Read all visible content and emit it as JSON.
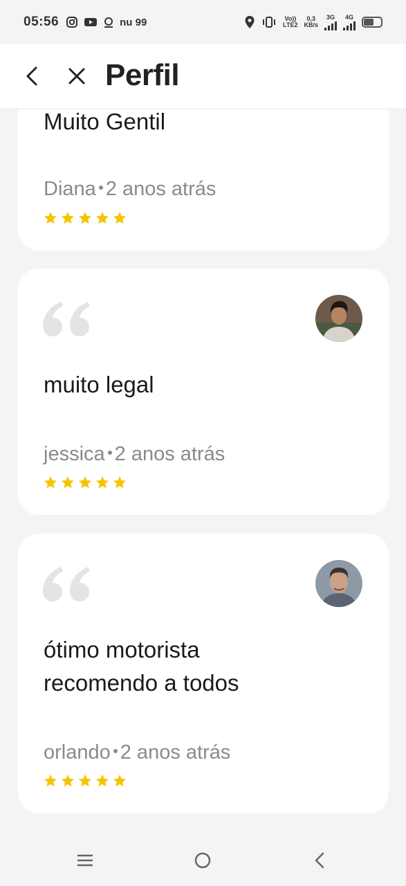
{
  "status_bar": {
    "time": "05:56",
    "carrier_text": "nu 99",
    "volte_label": "Vo))",
    "lte_label": "LTE2",
    "speed_value": "0,3",
    "speed_unit": "KB/s",
    "net1": "3G",
    "net2": "4G"
  },
  "header": {
    "title": "Perfil"
  },
  "reviews": [
    {
      "text": "Muito Gentil",
      "reviewer": "Diana",
      "time_ago": "2 anos atrás",
      "rating": 5
    },
    {
      "text": "muito legal",
      "reviewer": "jessica",
      "time_ago": "2 anos atrás",
      "rating": 5
    },
    {
      "text": "ótimo motorista\nrecomendo a todos",
      "reviewer": "orlando",
      "time_ago": "2 anos atrás",
      "rating": 5
    }
  ],
  "colors": {
    "star": "#f5c400",
    "quote": "#e4e4e7",
    "background": "#f4f4f6"
  }
}
